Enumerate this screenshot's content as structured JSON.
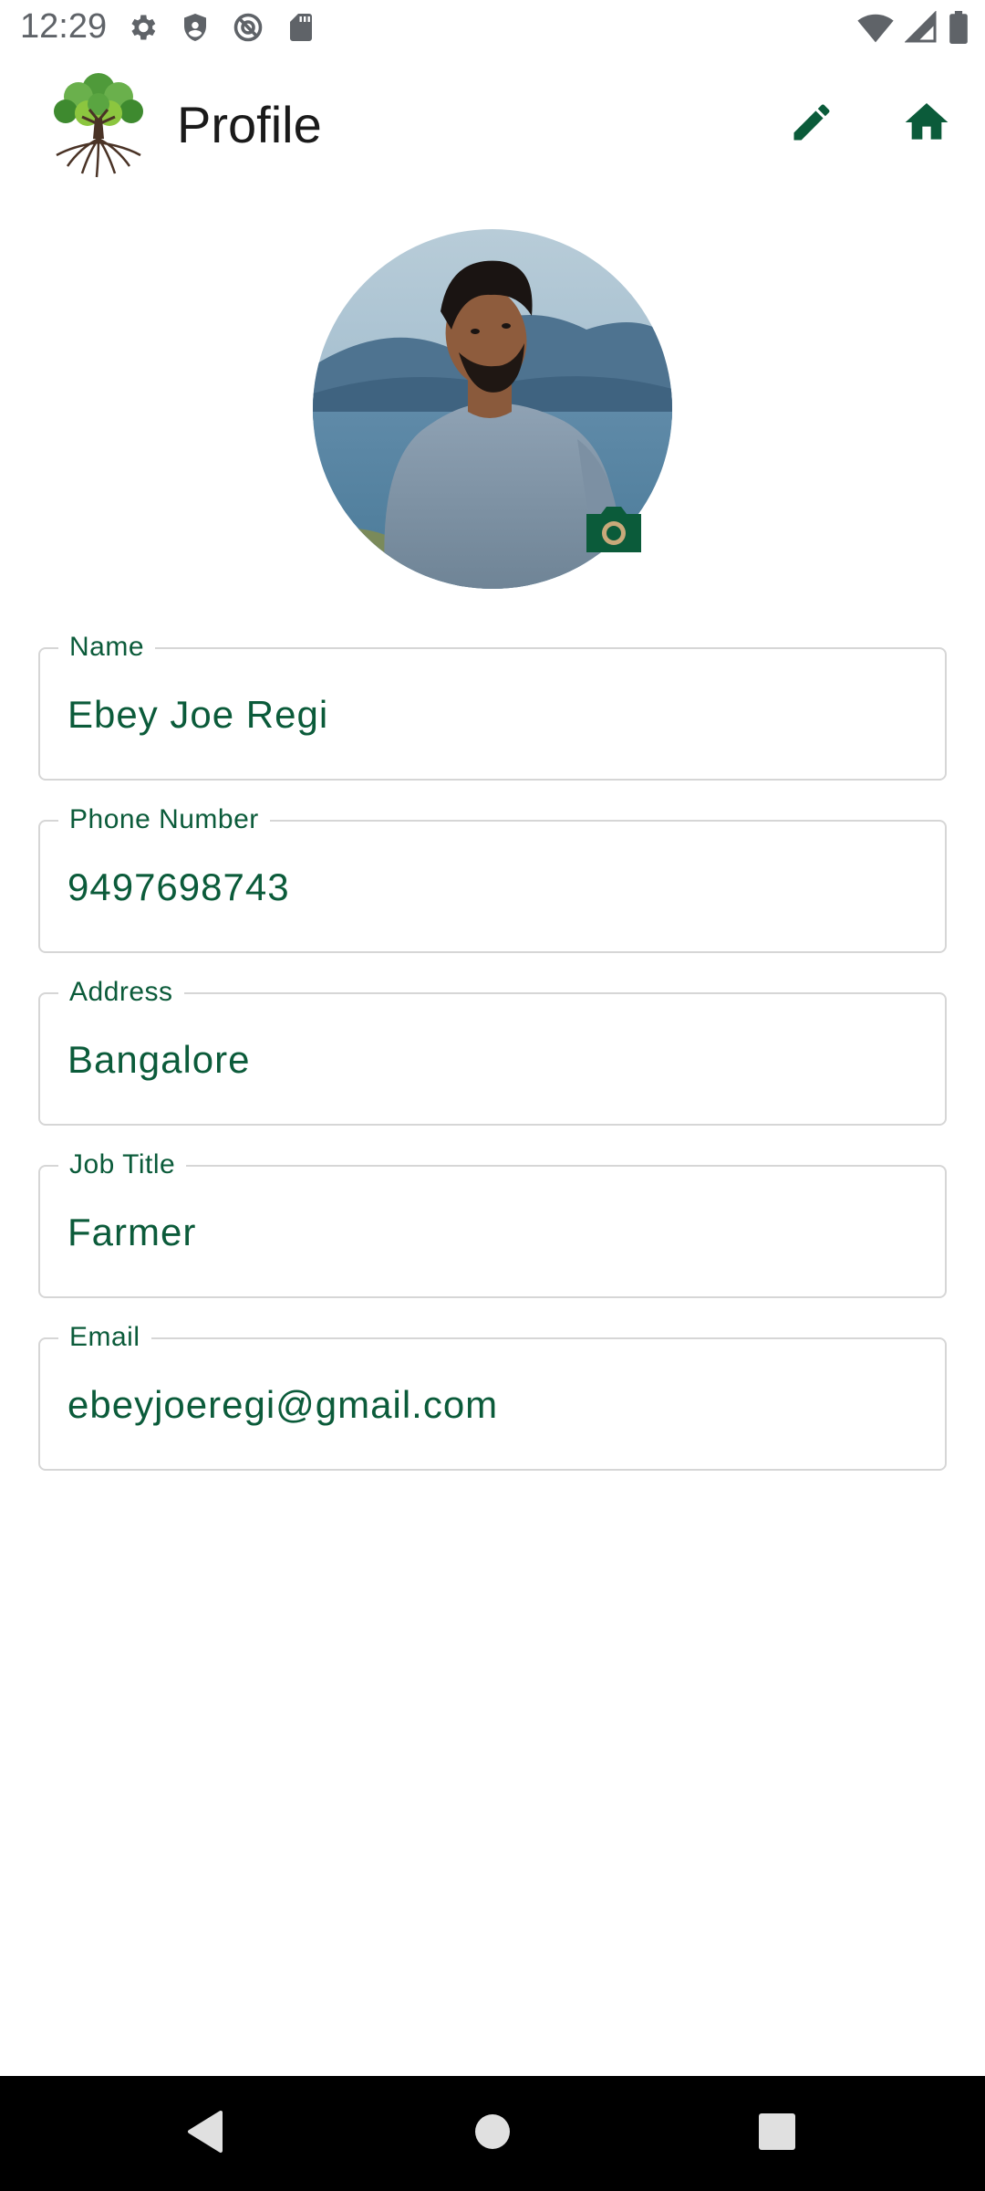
{
  "status_bar": {
    "time": "12:29",
    "left_icons": [
      "settings-icon",
      "shield-icon",
      "at-sign-icon",
      "sd-card-icon"
    ],
    "right_icons": [
      "wifi-icon",
      "cellular-signal-icon",
      "battery-icon"
    ]
  },
  "app_bar": {
    "logo_icon": "tree-logo-icon",
    "title": "Profile",
    "actions": [
      "edit-icon",
      "home-icon"
    ]
  },
  "profile": {
    "avatar": "profile-photo",
    "camera_icon": "camera-icon"
  },
  "form": {
    "fields": [
      {
        "label": "Name",
        "value": "Ebey Joe Regi"
      },
      {
        "label": "Phone Number",
        "value": "9497698743"
      },
      {
        "label": "Address",
        "value": "Bangalore"
      },
      {
        "label": "Job Title",
        "value": "Farmer"
      },
      {
        "label": "Email",
        "value": "ebeyjoeregi@gmail.com"
      }
    ]
  },
  "nav_bar": {
    "buttons": [
      "back-icon",
      "home-circle-icon",
      "recents-icon"
    ]
  },
  "colors": {
    "accent": "#0b5b3a",
    "field_border": "#d6d6d6",
    "nav_background": "#000000",
    "status_icon": "#5f6368"
  }
}
